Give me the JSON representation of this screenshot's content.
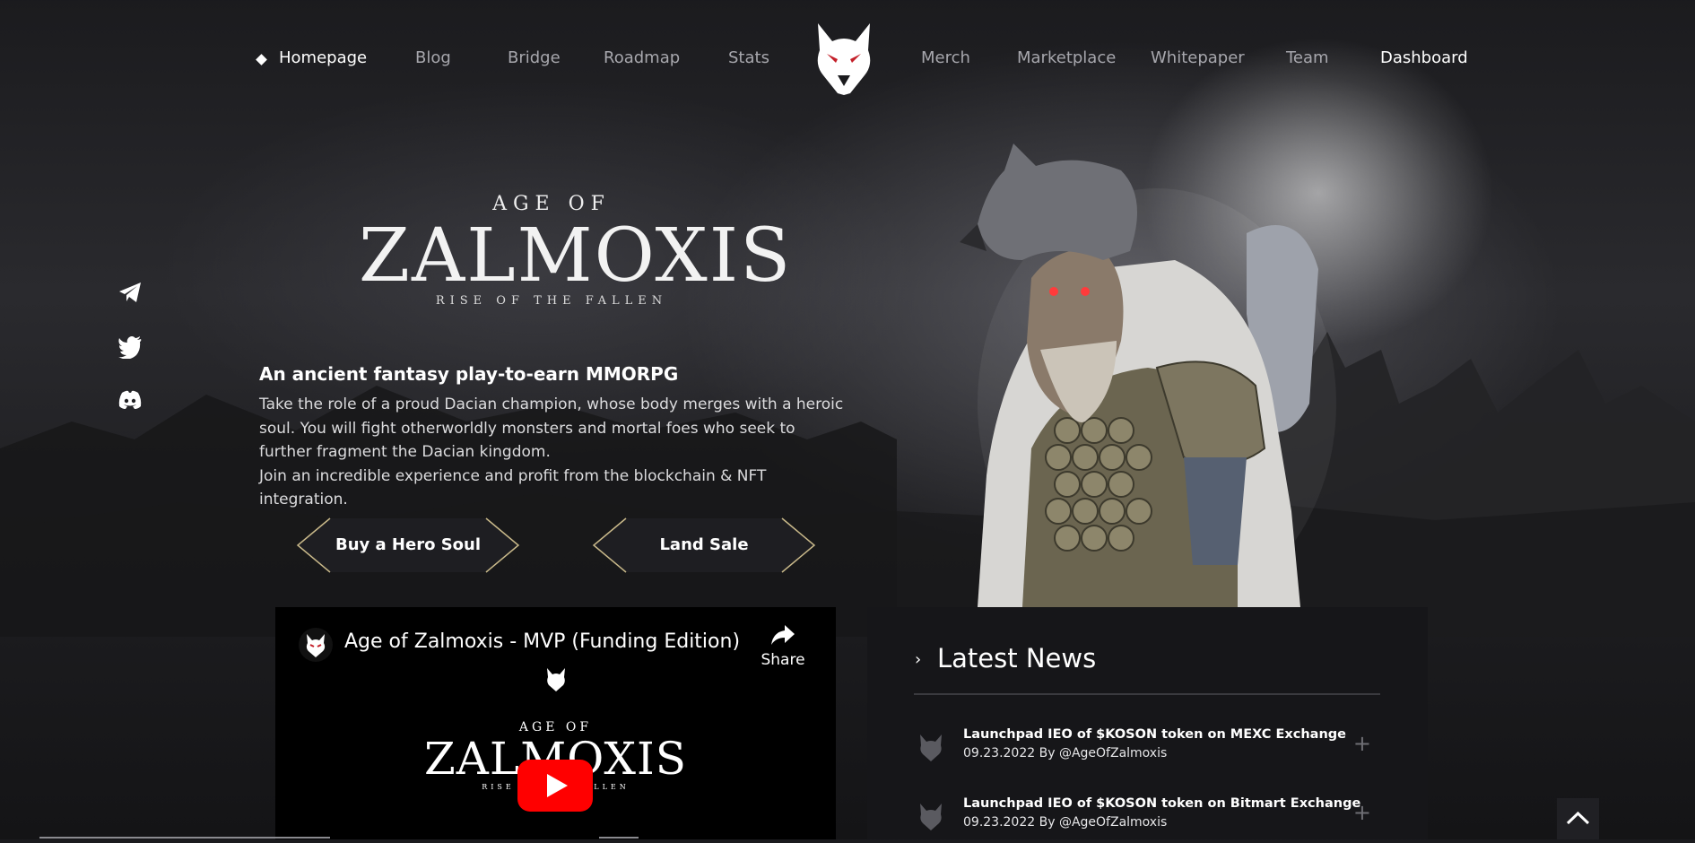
{
  "nav": {
    "items": [
      "Homepage",
      "Blog",
      "Bridge",
      "Roadmap",
      "Stats",
      "Merch",
      "Marketplace",
      "Whitepaper",
      "Team",
      "Dashboard"
    ],
    "active": "Homepage"
  },
  "socials": [
    "telegram-icon",
    "twitter-icon",
    "discord-icon"
  ],
  "hero": {
    "title_top": "AGE OF",
    "title_main": "ZALMOXIS",
    "title_sub": "RISE OF THE FALLEN",
    "tagline": "An ancient fantasy play-to-earn MMORPG",
    "paragraphs": [
      "Take the role of a proud Dacian champion, whose body merges with a heroic soul. You will fight otherworldly monsters and mortal foes who seek to further fragment the Dacian kingdom.",
      "Join an incredible experience and profit from the blockchain & NFT integration."
    ],
    "buttons": [
      "Buy a Hero Soul",
      "Land Sale"
    ]
  },
  "video": {
    "title": "Age of Zalmoxis - MVP (Funding Edition)",
    "share_label": "Share",
    "logo_top": "AGE OF",
    "logo_main": "ZALMOXIS",
    "logo_sub": "RISE OF THE FALLEN"
  },
  "news": {
    "heading": "Latest News",
    "items": [
      {
        "title": "Launchpad IEO of $KOSON token on MEXC Exchange",
        "meta": "09.23.2022 By @AgeOfZalmoxis"
      },
      {
        "title": "Launchpad IEO of $KOSON token on Bitmart Exchange",
        "meta": "09.23.2022 By @AgeOfZalmoxis"
      }
    ]
  },
  "colors": {
    "background": "#1e1e21",
    "panel": "#161619",
    "nav_inactive": "#a7a7ad",
    "accent_gold": "#c9b98a",
    "youtube_red": "#ff0000"
  }
}
